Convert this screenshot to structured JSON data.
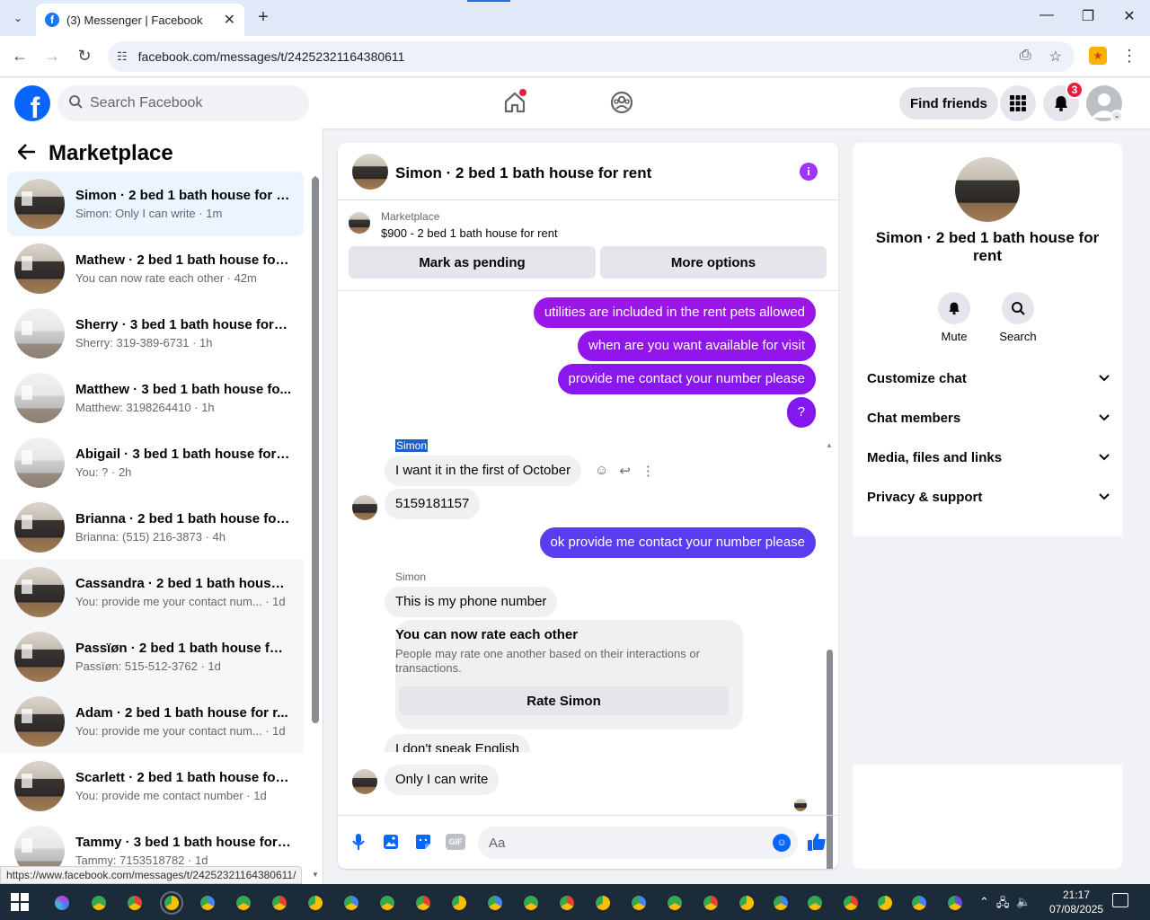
{
  "browser": {
    "tab_title": "(3) Messenger | Facebook",
    "url": "facebook.com/messages/t/24252321164380611",
    "status_url": "https://www.facebook.com/messages/t/24252321164380611/"
  },
  "header": {
    "search_placeholder": "Search Facebook",
    "find_friends": "Find friends",
    "notification_count": "3"
  },
  "sidebar": {
    "title": "Marketplace",
    "conversations": [
      {
        "name": "Simon · 2 bed 1 bath house for r...",
        "preview": "Simon: Only I can write · 1m",
        "thumb": "dark"
      },
      {
        "name": "Mathew · 2 bed 1 bath house for...",
        "preview": "You can now rate each other · 42m",
        "thumb": "dark"
      },
      {
        "name": "Sherry · 3 bed 1 bath house for r...",
        "preview": "Sherry: 319-389-6731 · 1h",
        "thumb": "light"
      },
      {
        "name": "Matthew · 3 bed 1 bath house fo...",
        "preview": "Matthew: 3198264410 · 1h",
        "thumb": "light"
      },
      {
        "name": "Abigail · 3 bed 1 bath house for ...",
        "preview": "You: ? · 2h",
        "thumb": "light"
      },
      {
        "name": "Brianna · 2 bed 1 bath house for ...",
        "preview": "Brianna: (515) 216-3873 · 4h",
        "thumb": "dark"
      },
      {
        "name": "Cassandra · 2 bed 1 bath house f...",
        "preview": "You: provide me your contact num... · 1d",
        "thumb": "dark"
      },
      {
        "name": "Passïøn · 2 bed 1 bath house for ...",
        "preview": "Passïøn: 515-512-3762 · 1d",
        "thumb": "dark"
      },
      {
        "name": "Adam · 2 bed 1 bath house for r...",
        "preview": "You: provide me your contact num... · 1d",
        "thumb": "dark"
      },
      {
        "name": "Scarlett · 2 bed 1 bath house for ...",
        "preview": "You: provide me contact number · 1d",
        "thumb": "dark"
      },
      {
        "name": "Tammy · 3 bed 1 bath house for ...",
        "preview": "Tammy: 7153518782 · 1d",
        "thumb": "light"
      }
    ]
  },
  "chat": {
    "title": "Simon · 2 bed 1 bath house for rent",
    "listing_label": "Marketplace",
    "listing_price": "$900 - 2 bed 1 bath house for rent",
    "mark_pending": "Mark as pending",
    "more_options": "More options",
    "out_messages": [
      "utilities are included in the rent pets allowed",
      "when are you want available for visit",
      "provide me contact your number please",
      "?"
    ],
    "sender_name": "Simon",
    "in_1": "I want it in the first of October",
    "in_2": "5159181157",
    "out_5": "ok provide me contact your number please",
    "in_3": "This is my phone number",
    "rate_title": "You can now rate each other",
    "rate_desc": "People may rate one another based on their interactions or transactions.",
    "rate_button": "Rate Simon",
    "in_4": "I don't speak English",
    "in_5": "Only I can write",
    "composer_placeholder": "Aa",
    "colors": {
      "out_purple": "#9b17e8",
      "out_blue": "#5b3cf0"
    }
  },
  "details": {
    "name": "Simon · 2 bed 1 bath house for rent",
    "mute": "Mute",
    "search": "Search",
    "rows": [
      "Customize chat",
      "Chat members",
      "Media, files and links",
      "Privacy & support"
    ]
  },
  "taskbar": {
    "time": "21:17",
    "date": "07/08/2025"
  }
}
